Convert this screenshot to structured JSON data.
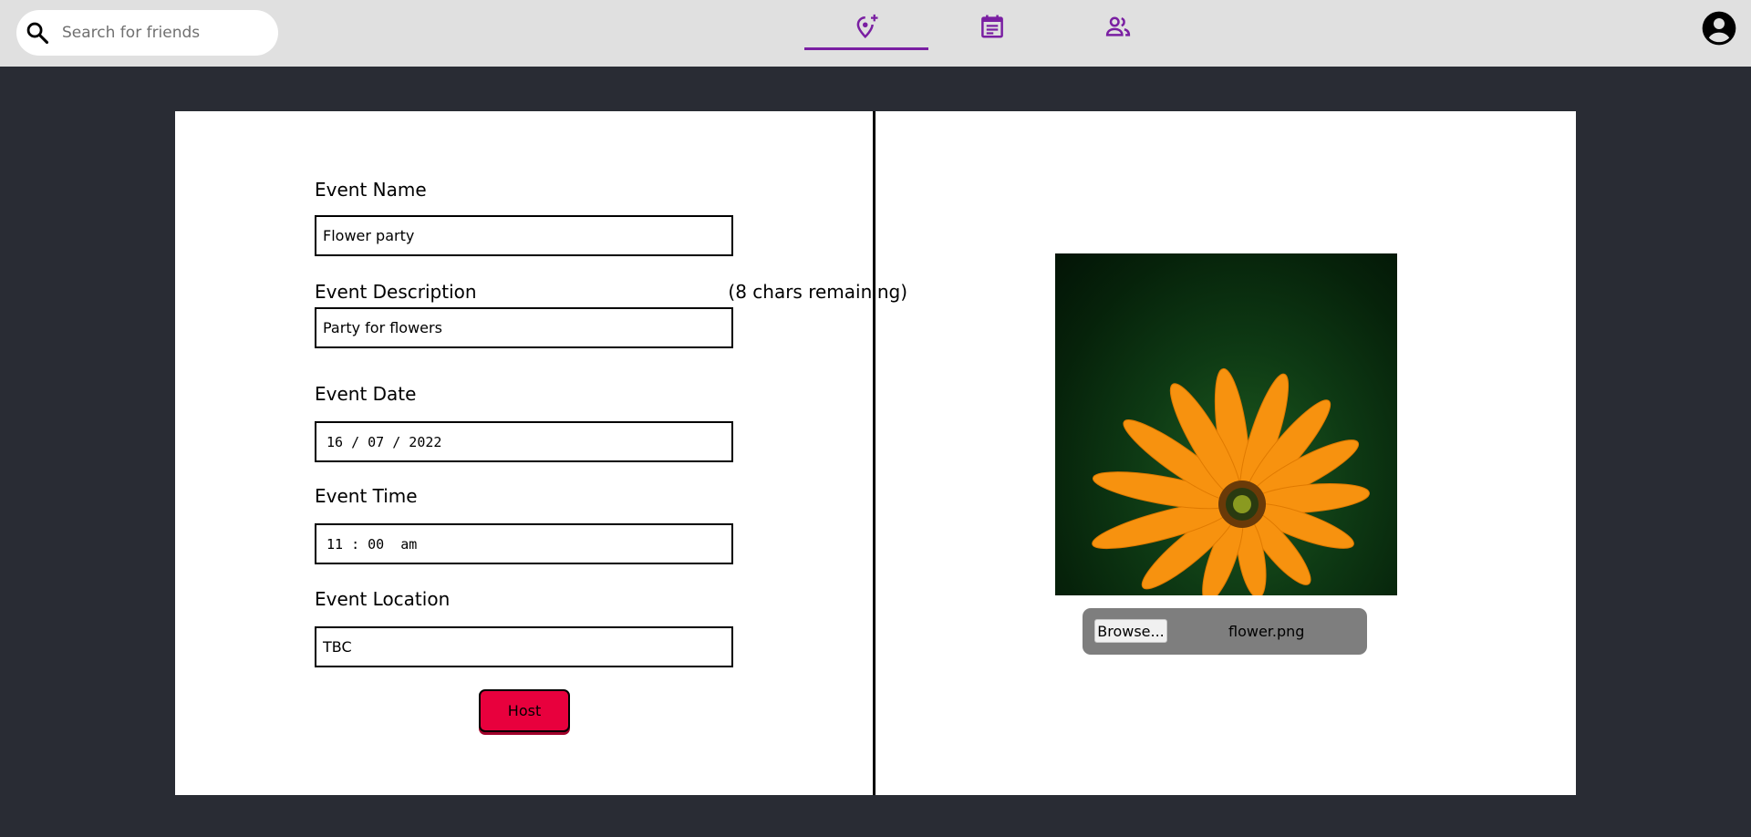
{
  "search": {
    "placeholder": "Search for friends",
    "icon": "search-icon"
  },
  "nav": {
    "tabs": [
      {
        "name": "host-event",
        "icon": "location-plus-icon",
        "active": true
      },
      {
        "name": "events",
        "icon": "calendar-list-icon",
        "active": false
      },
      {
        "name": "friends",
        "icon": "people-icon",
        "active": false
      }
    ],
    "accent_color": "#7a1fa2",
    "account_icon": "account-circle-icon"
  },
  "form": {
    "event_name": {
      "label": "Event Name",
      "value": "Flower party"
    },
    "event_description": {
      "label": "Event Description",
      "chars_remaining": "(8 chars remaining)",
      "value": "Party for flowers"
    },
    "event_date": {
      "label": "Event Date",
      "value": "16 / 07 / 2022"
    },
    "event_time": {
      "label": "Event Time",
      "value": "11 : 00  am"
    },
    "event_location": {
      "label": "Event Location",
      "value": "TBC"
    },
    "host_label": "Host",
    "host_color": "#e8003d"
  },
  "upload": {
    "browse_label": "Browse...",
    "file_name": "flower.png"
  }
}
